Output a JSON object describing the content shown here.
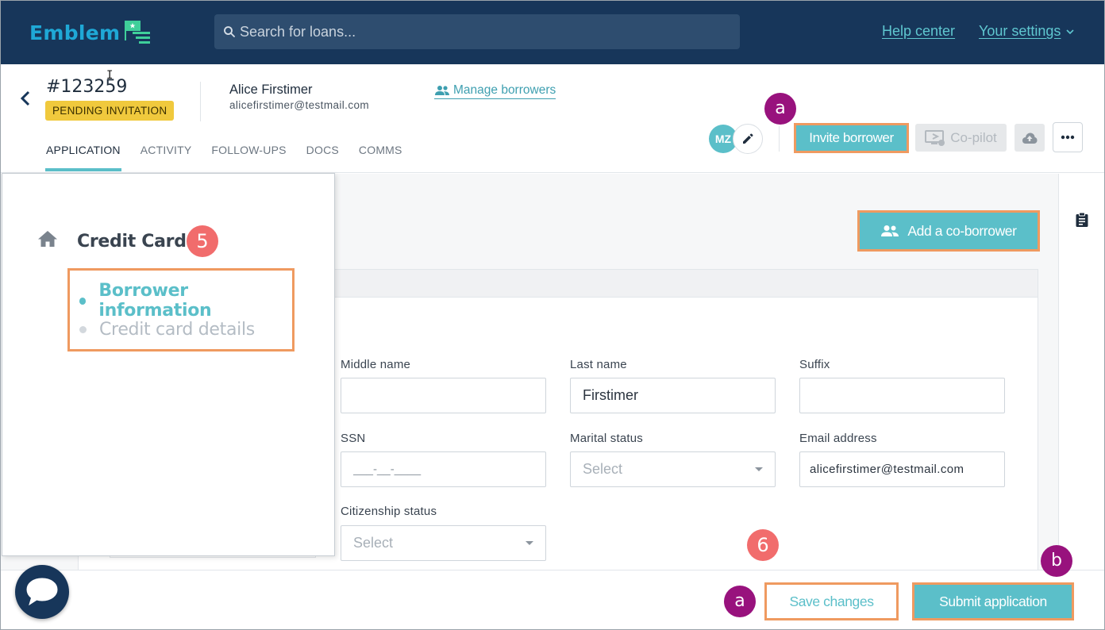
{
  "topbar": {
    "logo_text": "Emblem",
    "search_placeholder": "Search for loans...",
    "help_link": "Help center",
    "settings_link": "Your settings"
  },
  "loan": {
    "id": "#123259",
    "status": "PENDING INVITATION",
    "borrower_name": "Alice Firstimer",
    "borrower_email": "alicefirstimer@testmail.com",
    "manage_borrowers": "Manage borrowers",
    "cursor_glyph": "I"
  },
  "tabs": [
    {
      "label": "APPLICATION",
      "active": true
    },
    {
      "label": "ACTIVITY"
    },
    {
      "label": "FOLLOW-UPS"
    },
    {
      "label": "DOCS"
    },
    {
      "label": "COMMS"
    }
  ],
  "actions": {
    "avatar_initials": "MZ",
    "invite_borrower": "Invite borrower",
    "copilot": "Co-pilot",
    "add_coborrower": "Add a co-borrower",
    "save_changes": "Save changes",
    "submit_application": "Submit application"
  },
  "callouts": {
    "a_top": "a",
    "a_bottom": "a",
    "b": "b",
    "five": "5",
    "six": "6"
  },
  "nav": {
    "title": "Credit Card",
    "items": [
      {
        "label": "Borrower information",
        "active": true
      },
      {
        "label": "Credit card details",
        "active": false
      }
    ]
  },
  "form": {
    "middle_name": {
      "label": "Middle name",
      "value": ""
    },
    "last_name": {
      "label": "Last name",
      "value": "Firstimer"
    },
    "suffix": {
      "label": "Suffix",
      "value": ""
    },
    "ssn": {
      "label": "SSN",
      "value": "___-__-____"
    },
    "marital_status": {
      "label": "Marital status",
      "value": "Select"
    },
    "email": {
      "label": "Email address",
      "value": "alicefirstimer@testmail.com"
    },
    "citizenship": {
      "label": "Citizenship status",
      "value": "Select"
    }
  },
  "colors": {
    "topbar": "#17365a",
    "accent": "#5bbfc9",
    "highlight_border": "#ef9a60",
    "badge": "#f0c93d",
    "callout_purple": "#98127d",
    "callout_red": "#f16c6c"
  }
}
